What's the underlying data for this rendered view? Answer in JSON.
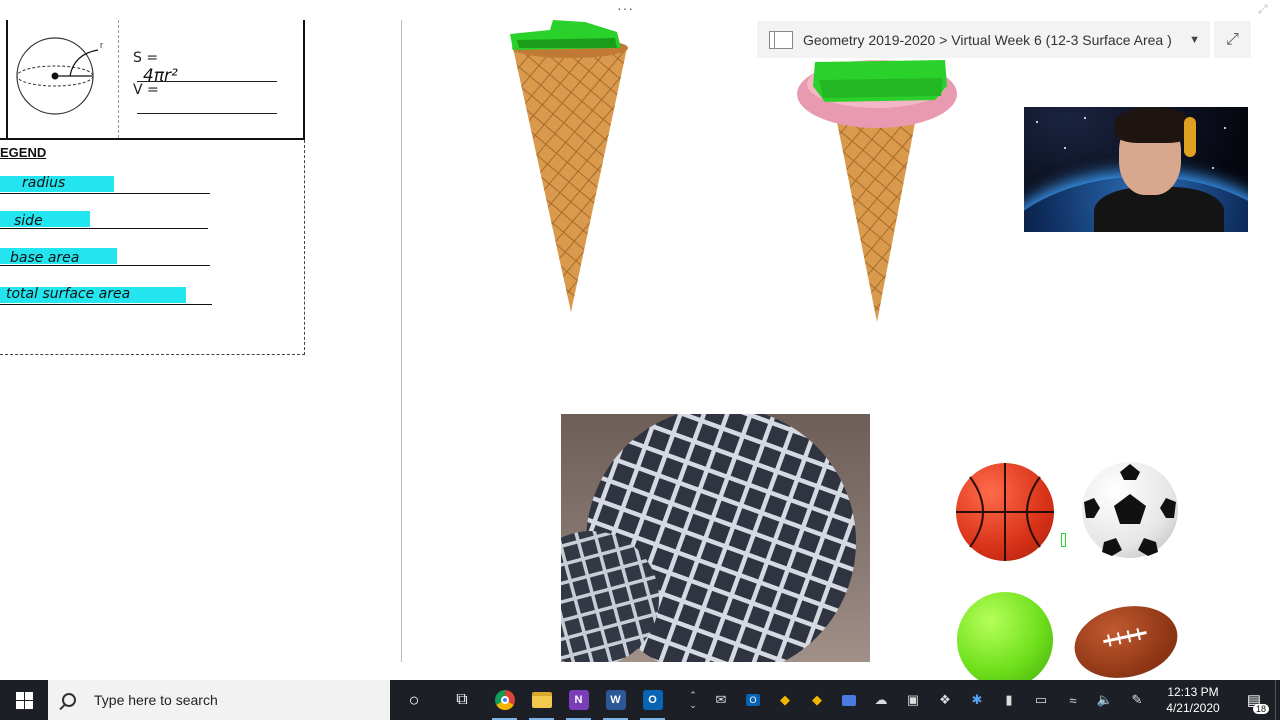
{
  "worksheet": {
    "formula_s_label": "S =",
    "formula_s_value": "4πr²",
    "formula_v_label": "V =",
    "sphere_r_label": "r",
    "legend_title": "EGEND",
    "legend_items": [
      {
        "text": "radius"
      },
      {
        "text": "side"
      },
      {
        "text": "base area"
      },
      {
        "text": "total surface area"
      }
    ]
  },
  "canvas": {
    "more_dots": "···"
  },
  "breadcrumb": {
    "text": "Geometry 2019-2020 > Virtual Week 6 (12-3 Surface Area )",
    "dropdown_icon": "chevron-down-icon",
    "expand_icon": "expand-icon"
  },
  "taskbar": {
    "search_placeholder": "Type here to search",
    "apps": [
      {
        "name": "cortana",
        "glyph": "○"
      },
      {
        "name": "task-view",
        "glyph": "⧉"
      },
      {
        "name": "chrome",
        "glyph": "",
        "color": "#e8b02a"
      },
      {
        "name": "file-explorer",
        "glyph": "",
        "color": "#f2c94c"
      },
      {
        "name": "onenote",
        "glyph": "N",
        "color": "#7a3db8"
      },
      {
        "name": "word",
        "glyph": "W",
        "color": "#2b5797"
      },
      {
        "name": "outlook",
        "glyph": "O",
        "color": "#0a64b4"
      }
    ],
    "clock_time": "12:13 PM",
    "clock_date": "4/21/2020",
    "notification_count": "18"
  }
}
